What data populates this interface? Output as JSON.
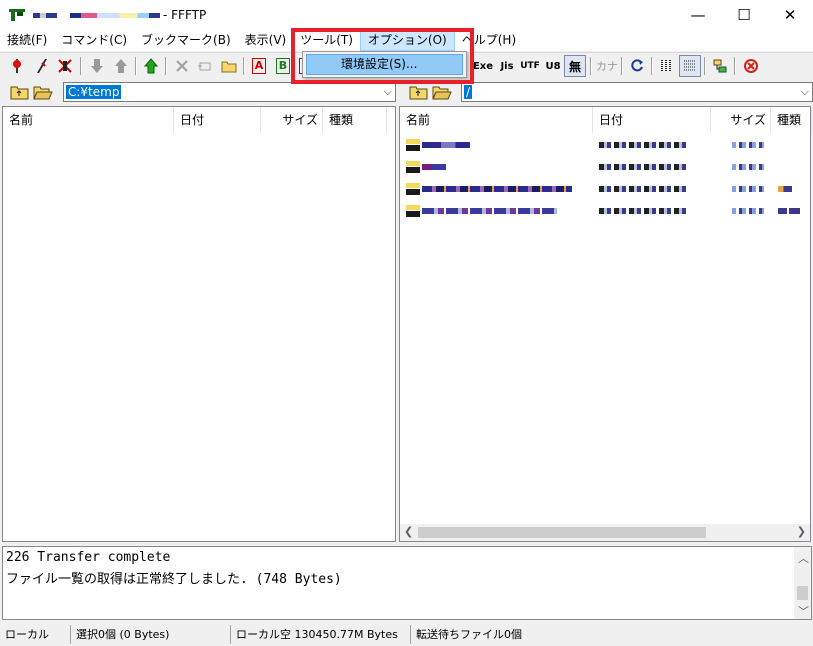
{
  "window": {
    "title": "- FFFTP",
    "minimize_glyph": "—",
    "maximize_glyph": "☐",
    "close_glyph": "✕"
  },
  "menu": {
    "items": [
      "接続(F)",
      "コマンド(C)",
      "ブックマーク(B)",
      "表示(V)",
      "ツール(T)",
      "オプション(O)",
      "ヘルプ(H)"
    ],
    "active_index": 5,
    "dropdown_item": "環境設定(S)..."
  },
  "toolbar": {
    "ascii_label": "A",
    "binary_label": "B",
    "exe_label": "Exe",
    "jis_label": "Jis",
    "utf_label": "UTF",
    "utf8_label": "U8",
    "no_convert_label": "無",
    "kana_label": "カナ"
  },
  "local": {
    "path": "C:¥temp",
    "columns": [
      "名前",
      "日付",
      "サイズ",
      "種類"
    ]
  },
  "remote": {
    "path": "/",
    "columns": [
      "名前",
      "日付",
      "サイズ",
      "種類"
    ]
  },
  "log": {
    "lines": [
      "226 Transfer complete",
      "ファイル一覧の取得は正常終了しました. (748 Bytes)"
    ]
  },
  "status": {
    "location": "ローカル",
    "selection": "選択0個 (0 Bytes)",
    "free_space": "ローカル空 130450.77M Bytes",
    "queue": "転送待ちファイル0個"
  },
  "colors": {
    "highlight": "#e8202a",
    "selection": "#0078d7",
    "menu_hover": "#91c9f7"
  }
}
